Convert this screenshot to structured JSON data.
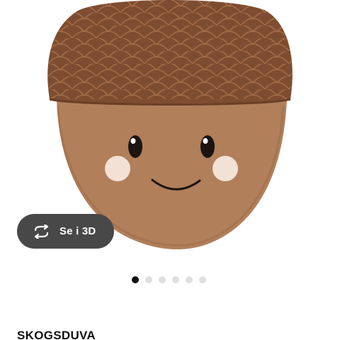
{
  "product": {
    "name": "SKOGSDUVA",
    "image_icon": "acorn-plush-image"
  },
  "view_3d": {
    "label": "Se i 3D",
    "icon": "rotate-3d-icon",
    "background": "#484848"
  },
  "carousel": {
    "total": 6,
    "active_index": 0,
    "active_color": "#111111",
    "inactive_color": "#dfdfdf"
  }
}
